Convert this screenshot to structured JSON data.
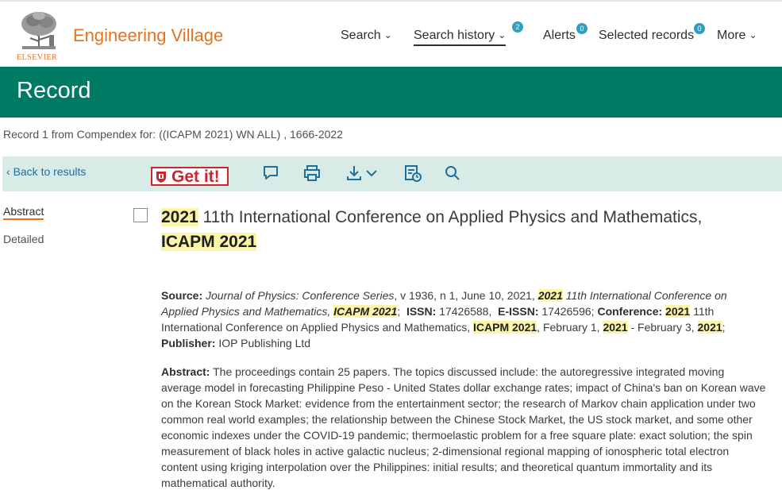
{
  "header": {
    "publisher_logo_text": "ELSEVIER",
    "brand": "Engineering Village",
    "nav": [
      {
        "label": "Search",
        "dropdown": true
      },
      {
        "label": "Search history",
        "dropdown": true,
        "badge": "2",
        "active": true
      },
      {
        "label": "Alerts",
        "badge": "0"
      },
      {
        "label": "Selected records",
        "badge": "0"
      },
      {
        "label": "More",
        "dropdown": true
      }
    ]
  },
  "banner": {
    "title": "Record"
  },
  "crumb": "Record 1 from Compendex for: ((ICAPM 2021) WN ALL) , 1666-2022",
  "toolbar": {
    "back_label": "Back to results",
    "getit_label": "Get it!",
    "icons": [
      "comment-icon",
      "print-icon",
      "download-icon",
      "save-to-folder-icon",
      "search-icon"
    ]
  },
  "sidebar": [
    {
      "label": "Abstract",
      "active": true
    },
    {
      "label": "Detailed",
      "active": false
    }
  ],
  "record": {
    "title_hl1": "2021",
    "title_mid": " 11th International Conference on Applied Physics and Mathematics,",
    "title_hl2": "ICAPM 2021",
    "source": {
      "label": "Source:",
      "journal": "Journal of Physics: Conference Series",
      "vol": ", v 1936, n 1, June 10, 2021,",
      "hl_year": "2021",
      "conf_italic": " 11th International Conference on Applied Physics and Mathematics,",
      "hl_icapm": "ICAPM 2021",
      "issn_label": "ISSN:",
      "issn": "17426588,",
      "eissn_label": "E-ISSN:",
      "eissn": "17426596;",
      "conference_label": "Conference:",
      "conf_hl_year": "2021",
      "conf_name": " 11th International Conference on Applied Physics and Mathematics,",
      "conf_hl_icapm": "ICAPM 2021",
      "conf_date_1": ", February 1,",
      "conf_hl_y2": "2021",
      "conf_date_2": " - February 3,",
      "conf_hl_y3": "2021",
      "publisher_label": "Publisher:",
      "publisher": "IOP Publishing Ltd"
    },
    "abstract": {
      "label": "Abstract:",
      "text": "The proceedings contain 25 papers. The topics discussed include: the autoregressive integrated moving average model in forecasting Philippine Peso - United States dollar exchange rates; impact of China's ban on Korean wave on the Korean Stock Market: evidence from the entertainment sector; the research of Markov chain application under two common real world examples; the relationship between the Chinese Stock Market, the US stock market, and some other economic indexes under the COVID-19 pandemic; thermoelastic problem for a free square plate: exact solution; the spin measurement of black holes in active galactic nucleus; 2-dimensional regional mapping of ionospheric total electron content using kriging interpolation over the Philippines: initial results; and theoretical quantum immortality and its mathematical authority."
    }
  },
  "colors": {
    "brand_orange": "#e9711c",
    "banner_green": "#007a62",
    "toolbar_bg": "#d9ebe6",
    "badge_blue": "#2fa0c4",
    "highlight": "#fbf5a8",
    "link_blue": "#1f6f9c",
    "getit_red": "#c9262e"
  }
}
